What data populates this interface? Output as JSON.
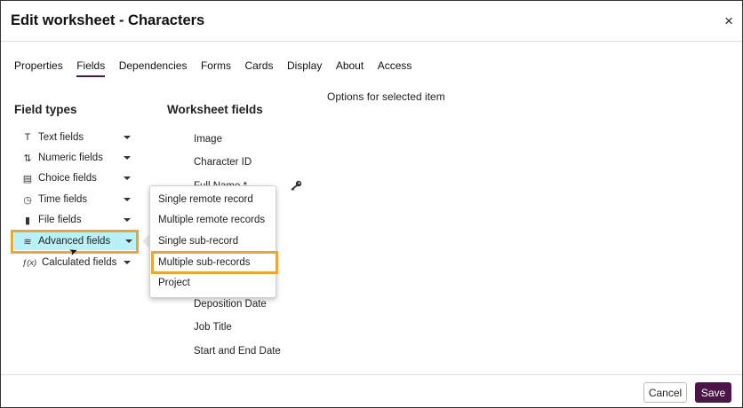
{
  "dialog": {
    "title": "Edit worksheet - Characters",
    "close_glyph": "×"
  },
  "tabs": [
    {
      "label": "Properties"
    },
    {
      "label": "Fields",
      "active": true
    },
    {
      "label": "Dependencies"
    },
    {
      "label": "Forms"
    },
    {
      "label": "Cards"
    },
    {
      "label": "Display"
    },
    {
      "label": "About"
    },
    {
      "label": "Access"
    }
  ],
  "field_types": {
    "title": "Field types",
    "items": [
      {
        "label": "Text fields",
        "icon": "text-icon",
        "glyph": "T"
      },
      {
        "label": "Numeric fields",
        "icon": "numeric-icon",
        "glyph": "⇅"
      },
      {
        "label": "Choice fields",
        "icon": "list-icon",
        "glyph": "▤"
      },
      {
        "label": "Time fields",
        "icon": "clock-icon",
        "glyph": "◷"
      },
      {
        "label": "File fields",
        "icon": "file-icon",
        "glyph": "▮"
      },
      {
        "label": "Advanced fields",
        "icon": "layers-icon",
        "glyph": "≋",
        "active": true
      },
      {
        "label": "Calculated fields",
        "icon": "function-icon",
        "glyph": "ƒ(x)"
      }
    ]
  },
  "worksheet_fields": {
    "title": "Worksheet fields",
    "items": [
      "Image",
      "Character ID",
      "Full Name *",
      "Deposition Date",
      "Job Title",
      "Start and End Date"
    ]
  },
  "options": {
    "title": "Options for selected item"
  },
  "advanced_menu": {
    "items": [
      "Single remote record",
      "Multiple remote records",
      "Single sub-record",
      "Multiple sub-records",
      "Project"
    ],
    "highlighted_index": 3
  },
  "footer": {
    "cancel_label": "Cancel",
    "save_label": "Save"
  },
  "colors": {
    "accent": "#4b1547",
    "highlight": "#e9a73a",
    "active_bg": "#b9f1f8"
  }
}
